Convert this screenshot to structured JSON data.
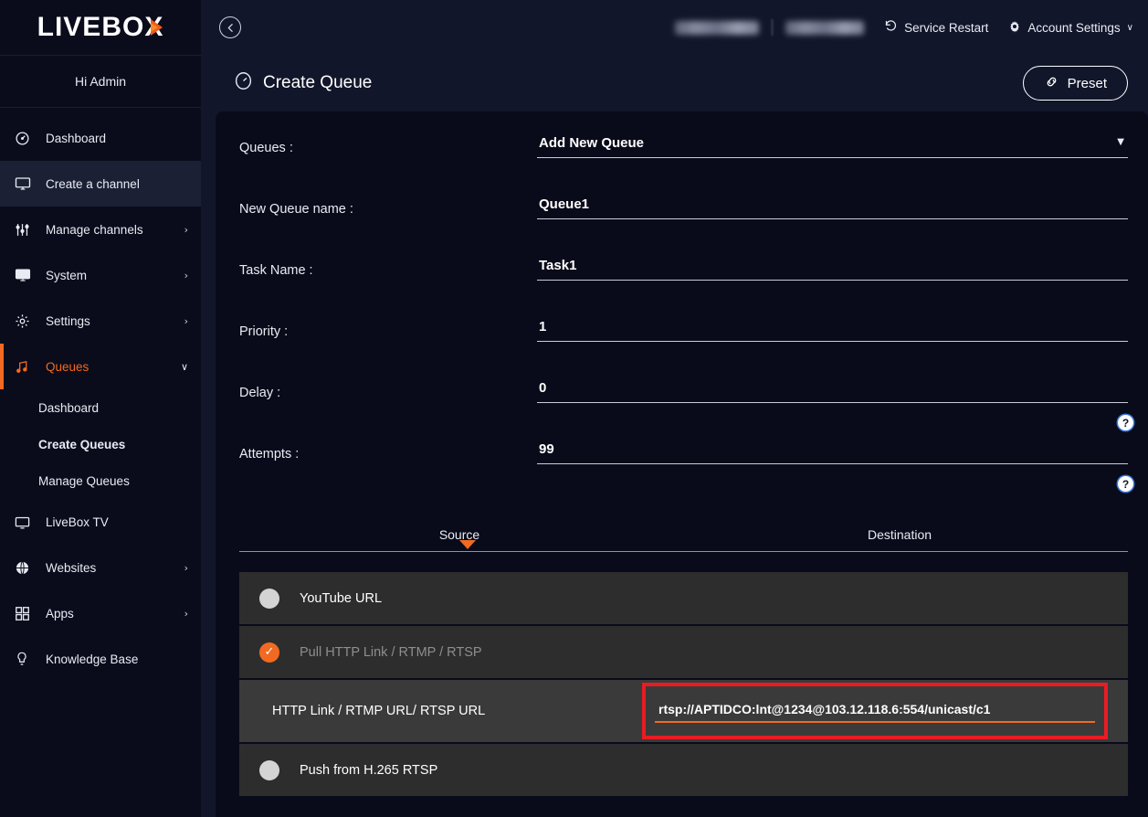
{
  "brand": {
    "logo_text": "LIVEBOX",
    "greeting": "Hi Admin"
  },
  "sidebar": {
    "items": [
      {
        "label": "Dashboard",
        "icon": "gauge-icon",
        "chevron": ""
      },
      {
        "label": "Create a channel",
        "icon": "monitor-icon",
        "chevron": ""
      },
      {
        "label": "Manage channels",
        "icon": "sliders-icon",
        "chevron": "›"
      },
      {
        "label": "System",
        "icon": "monitor-icon",
        "chevron": "›"
      },
      {
        "label": "Settings",
        "icon": "gear-icon",
        "chevron": "›"
      },
      {
        "label": "Queues",
        "icon": "music-note-icon",
        "chevron": "∨"
      },
      {
        "label": "LiveBox TV",
        "icon": "monitor-icon",
        "chevron": ""
      },
      {
        "label": "Websites",
        "icon": "globe-icon",
        "chevron": "›"
      },
      {
        "label": "Apps",
        "icon": "grid-icon",
        "chevron": "›"
      },
      {
        "label": "Knowledge Base",
        "icon": "bulb-icon",
        "chevron": ""
      }
    ],
    "queues_subitems": [
      {
        "label": "Dashboard"
      },
      {
        "label": "Create Queues"
      },
      {
        "label": "Manage Queues"
      }
    ]
  },
  "topbar": {
    "back_icon": "back-arrow-icon",
    "redacted_left": "",
    "redacted_right": "",
    "service_restart": "Service Restart",
    "account_settings": "Account Settings",
    "account_chevron": "∨"
  },
  "header": {
    "title": "Create Queue",
    "title_icon": "queue-circle-icon",
    "preset_label": "Preset",
    "preset_icon": "link-chain-icon"
  },
  "form": {
    "fields": [
      {
        "label": "Queues :",
        "value": "Add New Queue",
        "type": "select",
        "help": false
      },
      {
        "label": "New Queue name :",
        "value": "Queue1",
        "type": "text",
        "help": false
      },
      {
        "label": "Task Name :",
        "value": "Task1",
        "type": "text",
        "help": false
      },
      {
        "label": "Priority :",
        "value": "1",
        "type": "text",
        "help": false
      },
      {
        "label": "Delay :",
        "value": "0",
        "type": "text",
        "help": true
      },
      {
        "label": "Attempts :",
        "value": "99",
        "type": "text",
        "help": true
      }
    ],
    "help_glyph": "?",
    "select_arrow": "▼"
  },
  "tabs": [
    {
      "label": "Source",
      "active": true
    },
    {
      "label": "Destination",
      "active": false
    }
  ],
  "source_options": [
    {
      "label": "YouTube URL",
      "selected": false
    },
    {
      "label": "Pull HTTP Link / RTMP / RTSP",
      "selected": true
    },
    {
      "label": "Push from H.265 RTSP",
      "selected": false
    }
  ],
  "url_field": {
    "label": "HTTP Link / RTMP URL/ RTSP URL",
    "value": "rtsp://APTIDCO:lnt@1234@103.12.118.6:554/unicast/c1",
    "placeholder": "HTTP Link / RTMP URL/ RTSP URL"
  },
  "check_glyph": "✓",
  "colors": {
    "accent_orange": "#f26a21",
    "highlight_red": "#e81c23",
    "sidebar_bg": "#0a0c1b",
    "panel_bg": "#0a0b1a",
    "app_bg": "#12162a",
    "option_row": "#2d2d2d"
  }
}
